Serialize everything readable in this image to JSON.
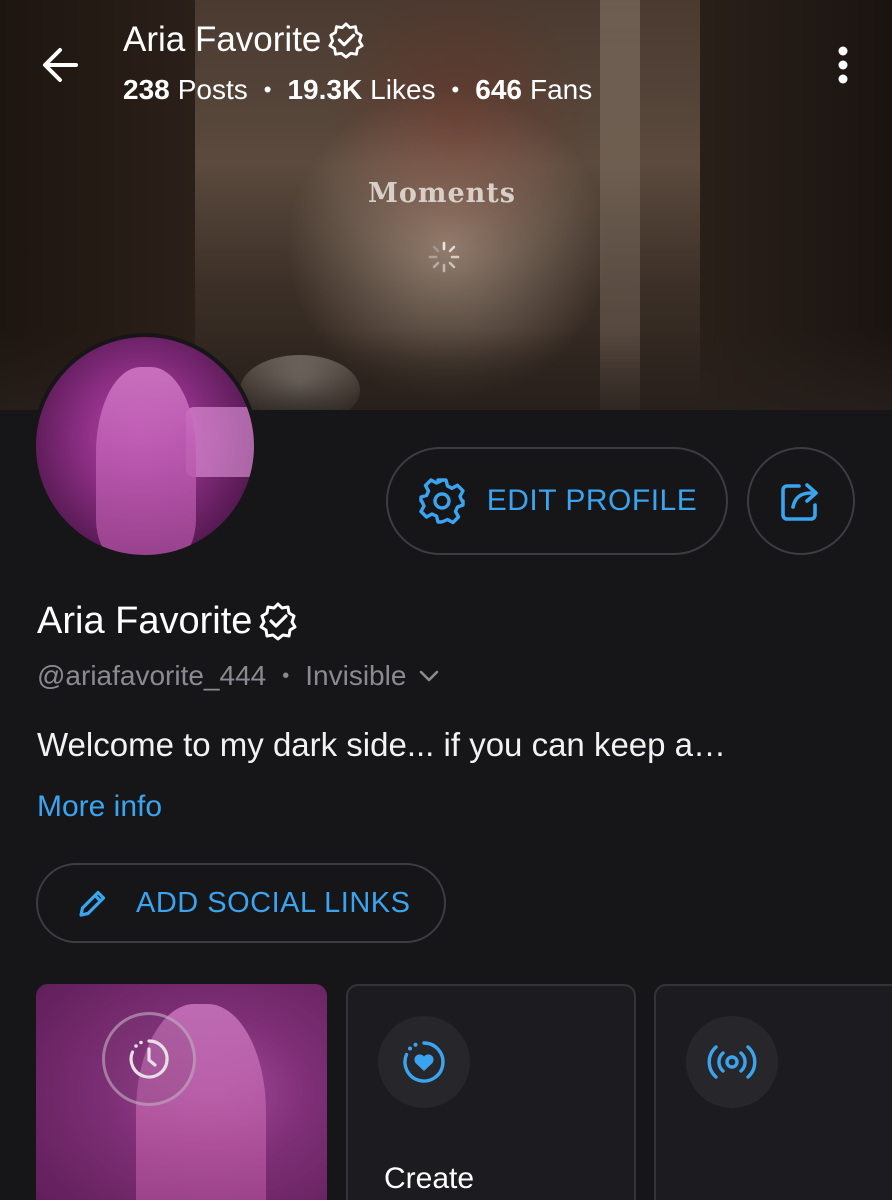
{
  "header": {
    "title": "Aria Favorite",
    "stats": [
      {
        "value": "238",
        "label": "Posts"
      },
      {
        "value": "19.3K",
        "label": "Likes"
      },
      {
        "value": "646",
        "label": "Fans"
      }
    ],
    "cover_text": "Moments"
  },
  "profile": {
    "name": "Aria Favorite",
    "handle": "@ariafavorite_444",
    "status": "Invisible",
    "bio": "Welcome to my dark side... if you can keep a…",
    "more_info": "More info"
  },
  "buttons": {
    "edit_profile": "EDIT PROFILE",
    "add_social_links": "ADD SOCIAL LINKS"
  },
  "cards": [
    {
      "icon": "timer-icon",
      "label": ""
    },
    {
      "icon": "heart-progress-icon",
      "label": "Create"
    },
    {
      "icon": "live-broadcast-icon",
      "label": ""
    }
  ],
  "colors": {
    "accent": "#3aa4ef",
    "background": "#161618",
    "muted": "#8a8a93"
  }
}
